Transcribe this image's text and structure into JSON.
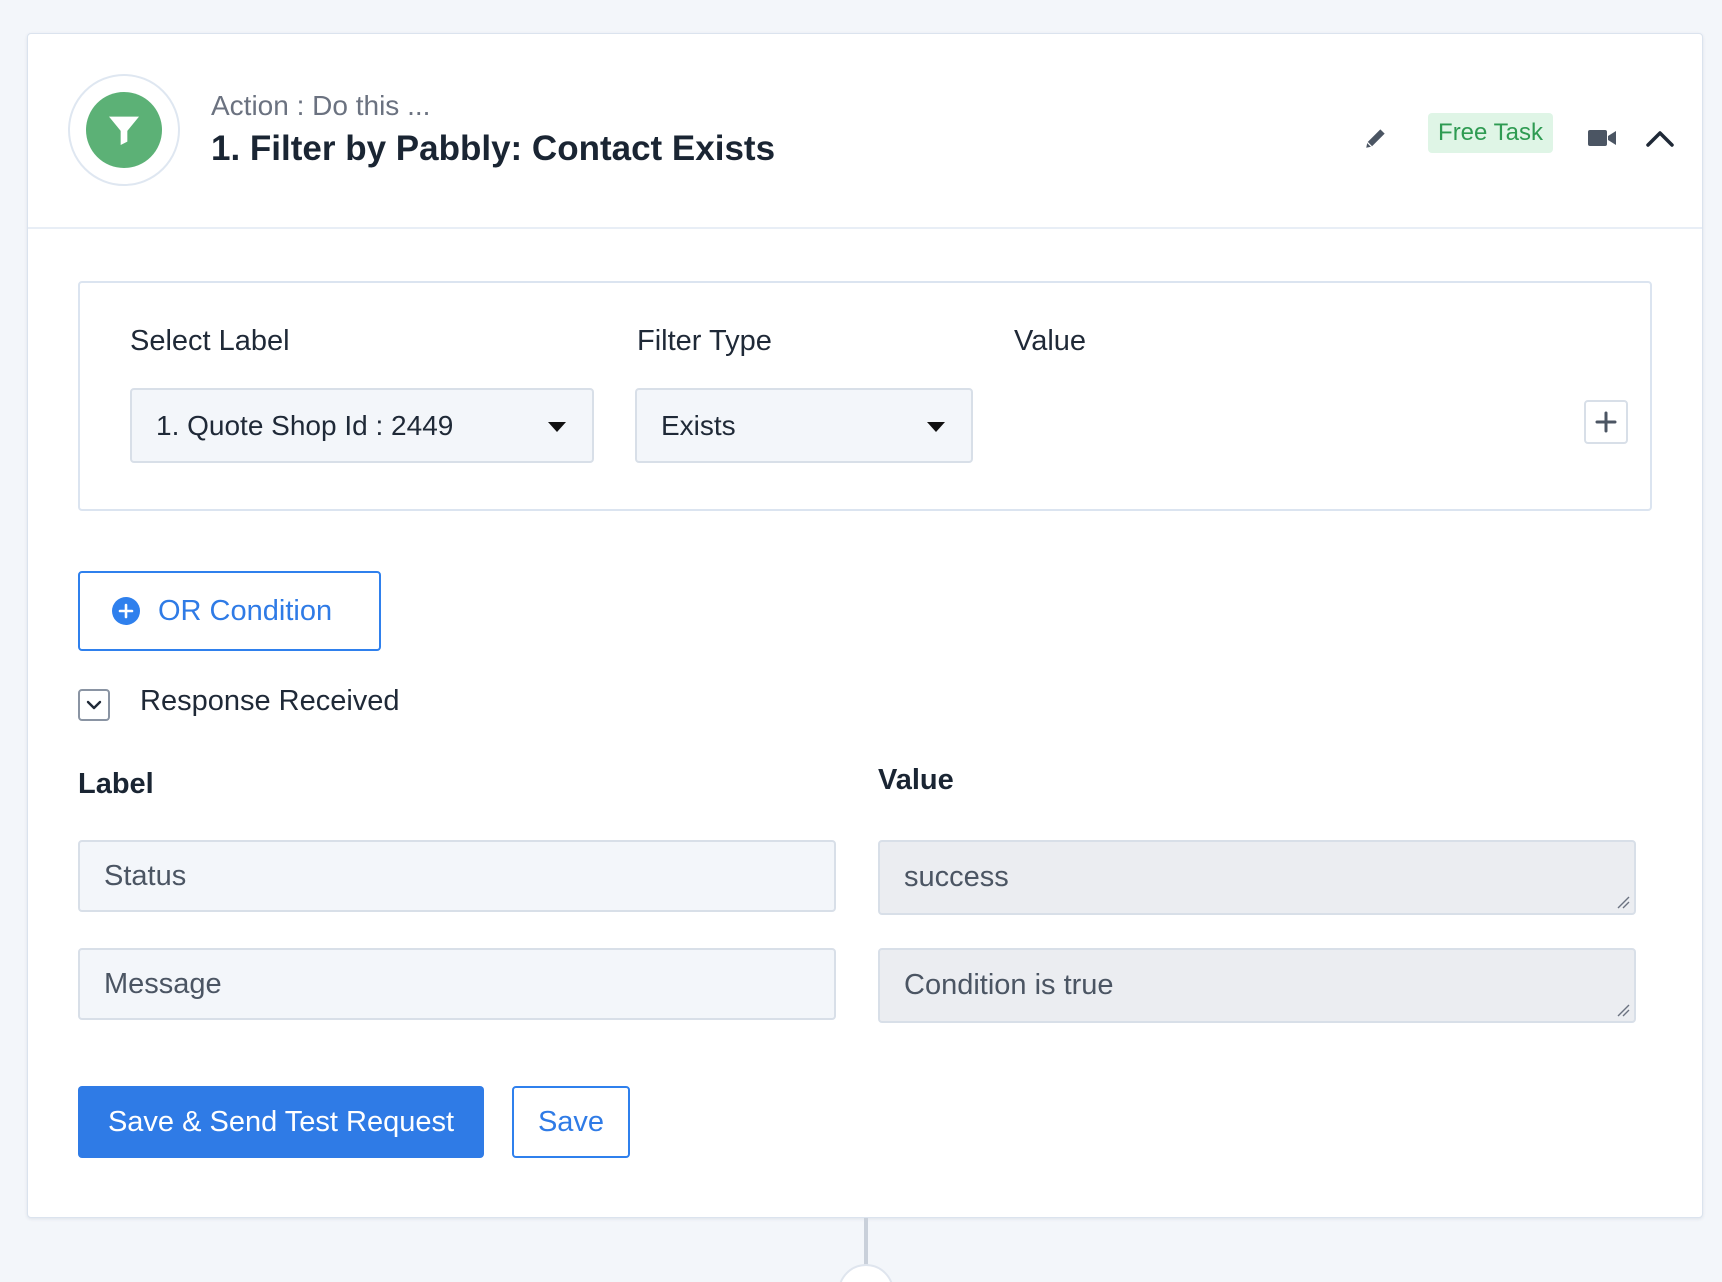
{
  "header": {
    "kicker": "Action : Do this ...",
    "title": "1. Filter by Pabbly: Contact Exists",
    "badge": "Free Task",
    "app_icon": "filter-icon",
    "icons": [
      "pencil-icon",
      "video-camera-icon",
      "chevron-up-icon"
    ],
    "app_color": "#5cb176"
  },
  "filter": {
    "select_label_heading": "Select Label",
    "filter_type_heading": "Filter Type",
    "value_heading": "Value",
    "selected_label": "1. Quote Shop Id : 2449",
    "selected_filter_type": "Exists",
    "add_icon": "plus-icon"
  },
  "or_condition": {
    "label": "OR Condition",
    "icon": "plus-circle-icon"
  },
  "response": {
    "toggle_label": "Response Received",
    "label_heading": "Label",
    "value_heading": "Value",
    "rows": [
      {
        "label": "Status",
        "value": "success"
      },
      {
        "label": "Message",
        "value": "Condition is true"
      }
    ]
  },
  "actions": {
    "primary": "Save & Send Test Request",
    "secondary": "Save"
  },
  "colors": {
    "accent": "#2f7be6",
    "badge_bg": "#dff5e6",
    "badge_text": "#2e9b52"
  }
}
